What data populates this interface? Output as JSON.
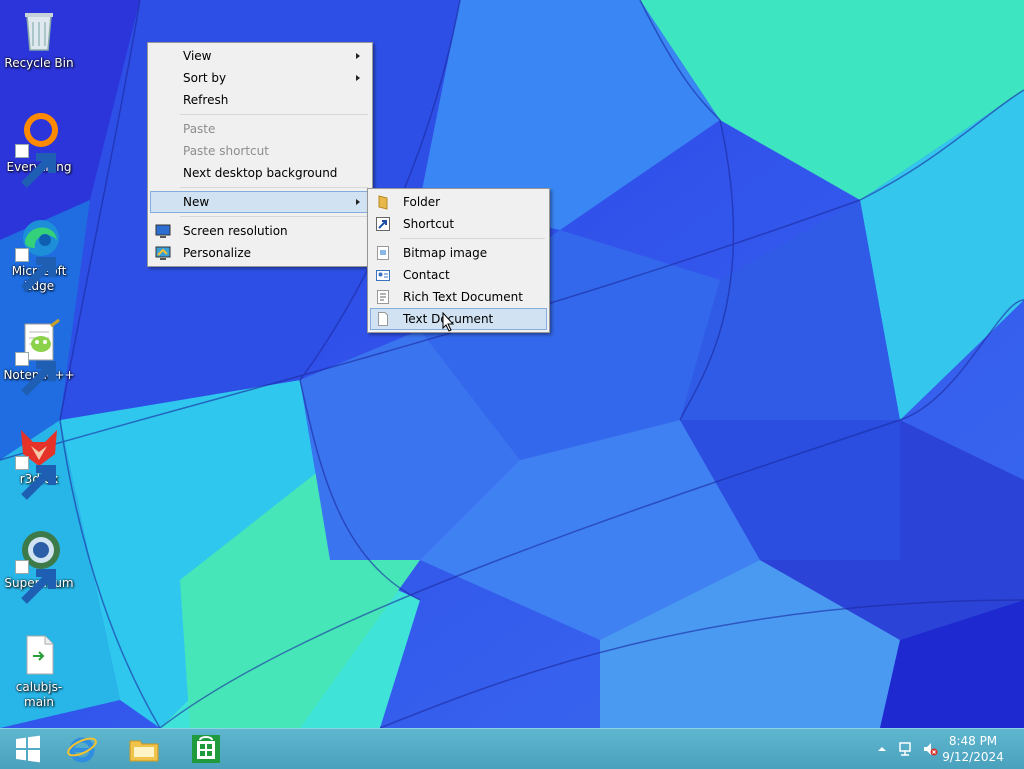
{
  "desktop": {
    "icons": [
      {
        "label": "Recycle Bin",
        "icon": "recycle-bin-icon"
      },
      {
        "label": "Everything",
        "icon": "everything-icon"
      },
      {
        "label": "Microsoft\nEdge",
        "icon": "edge-icon"
      },
      {
        "label": "Notepad++",
        "icon": "notepadpp-icon"
      },
      {
        "label": "r3dfox",
        "icon": "r3dfox-icon"
      },
      {
        "label": "Supermium",
        "icon": "supermium-icon"
      },
      {
        "label": "calubjs-main",
        "icon": "file-icon"
      }
    ]
  },
  "context_menu": {
    "view": "View",
    "sort_by": "Sort by",
    "refresh": "Refresh",
    "paste": "Paste",
    "paste_shortcut": "Paste shortcut",
    "next_background": "Next desktop background",
    "new": "New",
    "screen_resolution": "Screen resolution",
    "personalize": "Personalize"
  },
  "new_submenu": {
    "folder": "Folder",
    "shortcut": "Shortcut",
    "bitmap": "Bitmap image",
    "contact": "Contact",
    "rich_text": "Rich Text Document",
    "text_document": "Text Document"
  },
  "taskbar": {
    "time": "8:48 PM",
    "date": "9/12/2024"
  },
  "colors": {
    "menu_highlight": "#d1e2f2",
    "taskbar": "#4aa1bd"
  }
}
